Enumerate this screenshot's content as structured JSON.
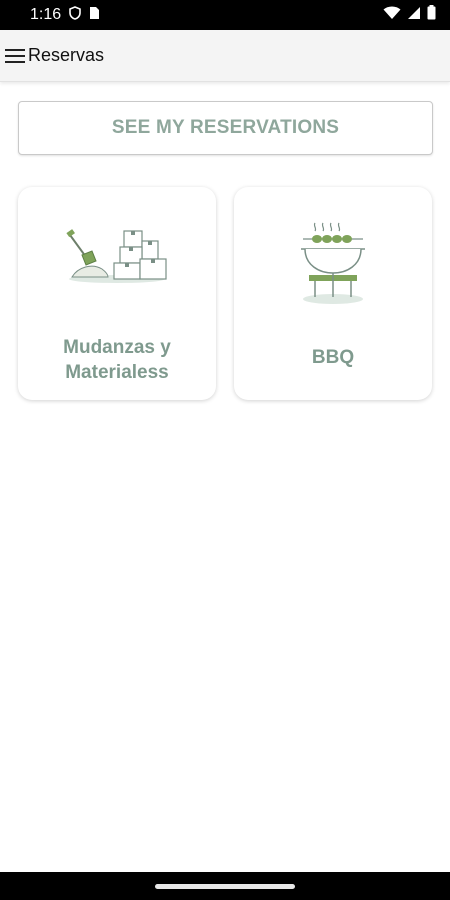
{
  "status_bar": {
    "time": "1:16",
    "icons": [
      "shield-icon",
      "sim-card-icon",
      "wifi-icon",
      "signal-icon",
      "battery-icon"
    ]
  },
  "app_bar": {
    "title": "Reservas",
    "menu_icon": "hamburger-menu-icon"
  },
  "see_reservations": {
    "label": "SEE MY RESERVATIONS"
  },
  "cards": [
    {
      "label": "Mudanzas y Materialess",
      "icon": "moving-boxes-shovel-icon"
    },
    {
      "label": "BBQ",
      "icon": "bbq-grill-icon"
    }
  ],
  "colors": {
    "accent_text": "#8fa79c",
    "icon_green": "#7fa35a",
    "app_bar_bg": "#f4f4f4"
  }
}
